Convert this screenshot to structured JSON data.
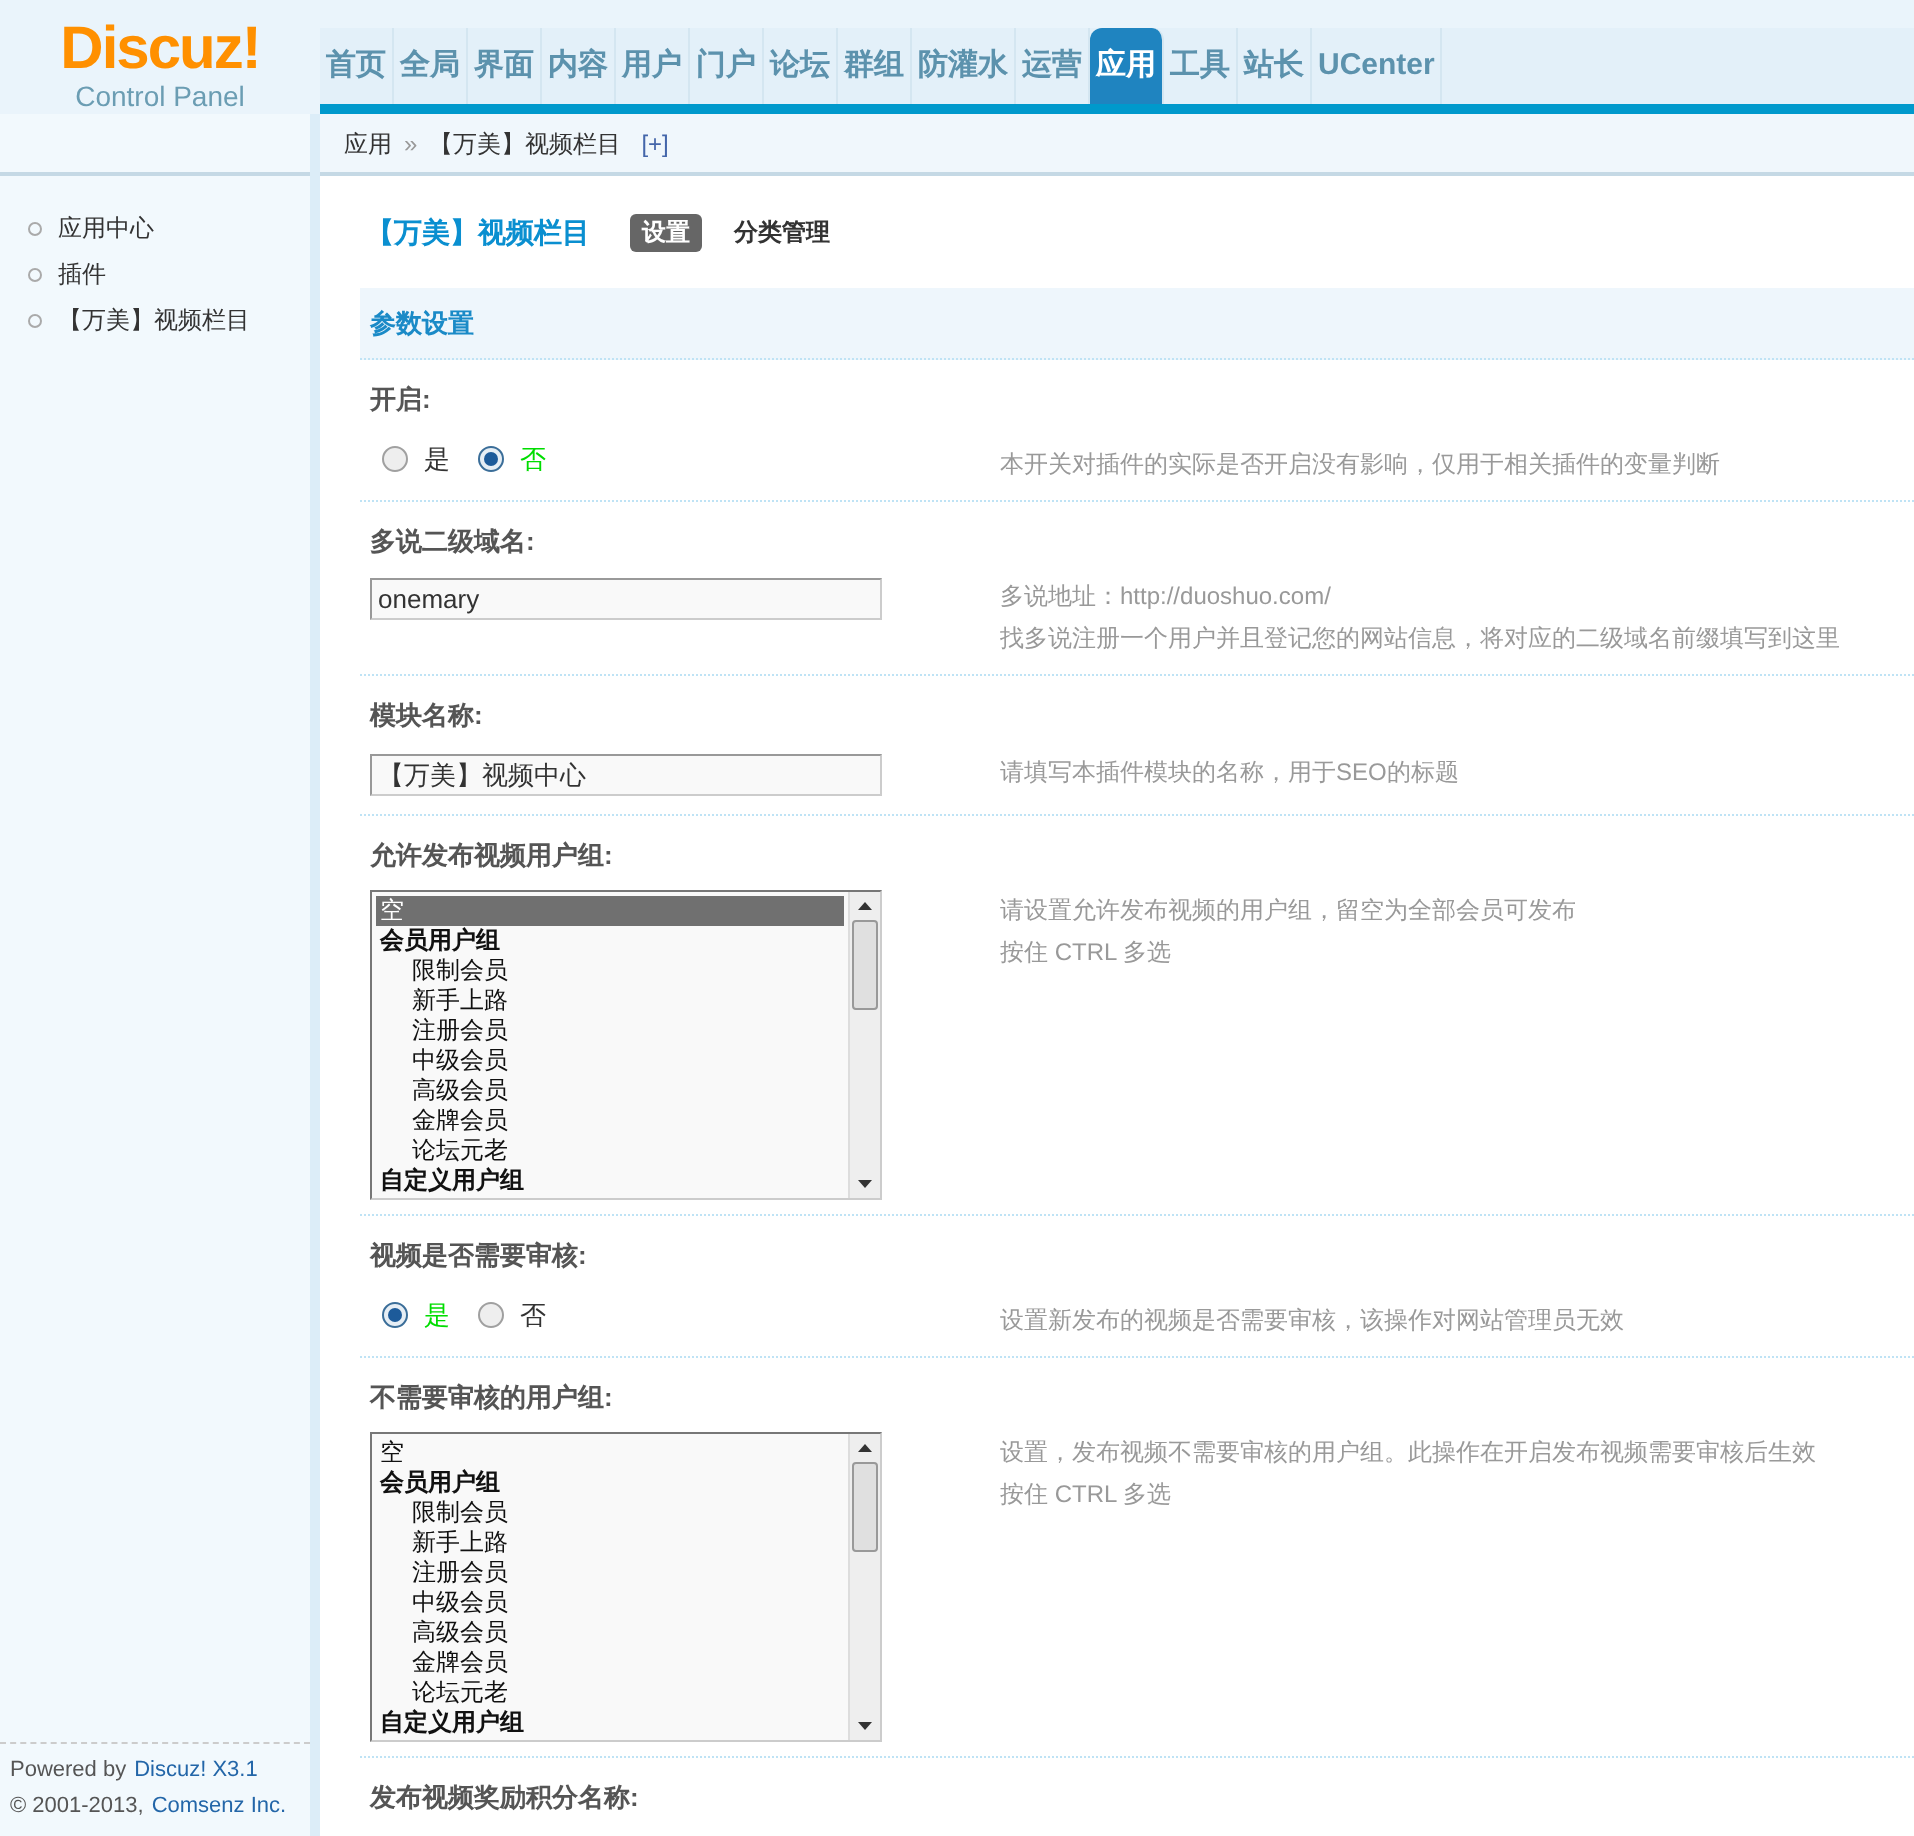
{
  "logo": {
    "brand": "Discuz!",
    "subtitle": "Control Panel"
  },
  "nav": [
    {
      "label": "首页",
      "selected": false
    },
    {
      "label": "全局",
      "selected": false
    },
    {
      "label": "界面",
      "selected": false
    },
    {
      "label": "内容",
      "selected": false
    },
    {
      "label": "用户",
      "selected": false
    },
    {
      "label": "门户",
      "selected": false
    },
    {
      "label": "论坛",
      "selected": false
    },
    {
      "label": "群组",
      "selected": false
    },
    {
      "label": "防灌水",
      "selected": false
    },
    {
      "label": "运营",
      "selected": false
    },
    {
      "label": "应用",
      "selected": true
    },
    {
      "label": "工具",
      "selected": false
    },
    {
      "label": "站长",
      "selected": false
    },
    {
      "label": "UCenter",
      "selected": false
    }
  ],
  "breadcrumb": {
    "items": [
      "应用",
      "【万美】视频栏目"
    ],
    "separator": "»",
    "add": "[+]"
  },
  "sidebar": {
    "items": [
      {
        "label": "应用中心"
      },
      {
        "label": "插件"
      },
      {
        "label": "【万美】视频栏目"
      }
    ]
  },
  "footer": {
    "powered": "Powered by",
    "product": "Discuz! X3.1",
    "copyright": "© 2001-2013,",
    "company": "Comsenz Inc."
  },
  "page": {
    "title": "【万美】视频栏目",
    "tabs": [
      {
        "label": "设置",
        "selected": true
      },
      {
        "label": "分类管理",
        "selected": false
      }
    ],
    "section": "参数设置"
  },
  "fields": [
    {
      "kind": "radio",
      "label": "开启:",
      "options": [
        {
          "label": "是",
          "selected": false
        },
        {
          "label": "否",
          "selected": true
        }
      ],
      "description": [
        "本开关对插件的实际是否开启没有影响，仅用于相关插件的变量判断"
      ]
    },
    {
      "kind": "text",
      "label": "多说二级域名:",
      "value": "onemary",
      "description": [
        "多说地址：http://duoshuo.com/",
        "找多说注册一个用户并且登记您的网站信息，将对应的二级域名前缀填写到这里"
      ]
    },
    {
      "kind": "text",
      "label": "模块名称:",
      "value": "【万美】视频中心",
      "description": [
        "请填写本插件模块的名称，用于SEO的标题"
      ]
    },
    {
      "kind": "multiselect",
      "label": "允许发布视频用户组:",
      "options": [
        {
          "label": "空",
          "kind": "empty",
          "selected": true
        },
        {
          "label": "会员用户组",
          "kind": "group",
          "selected": false
        },
        {
          "label": "限制会员",
          "kind": "item",
          "selected": false
        },
        {
          "label": "新手上路",
          "kind": "item",
          "selected": false
        },
        {
          "label": "注册会员",
          "kind": "item",
          "selected": false
        },
        {
          "label": "中级会员",
          "kind": "item",
          "selected": false
        },
        {
          "label": "高级会员",
          "kind": "item",
          "selected": false
        },
        {
          "label": "金牌会员",
          "kind": "item",
          "selected": false
        },
        {
          "label": "论坛元老",
          "kind": "item",
          "selected": false
        },
        {
          "label": "自定义用户组",
          "kind": "group",
          "selected": false
        }
      ],
      "description": [
        "请设置允许发布视频的用户组，留空为全部会员可发布",
        "按住 CTRL 多选"
      ]
    },
    {
      "kind": "radio",
      "label": "视频是否需要审核:",
      "options": [
        {
          "label": "是",
          "selected": true
        },
        {
          "label": "否",
          "selected": false
        }
      ],
      "description": [
        "设置新发布的视频是否需要审核，该操作对网站管理员无效"
      ]
    },
    {
      "kind": "multiselect",
      "label": "不需要审核的用户组:",
      "options": [
        {
          "label": "空",
          "kind": "empty",
          "selected": false
        },
        {
          "label": "会员用户组",
          "kind": "group",
          "selected": false
        },
        {
          "label": "限制会员",
          "kind": "item",
          "selected": false
        },
        {
          "label": "新手上路",
          "kind": "item",
          "selected": false
        },
        {
          "label": "注册会员",
          "kind": "item",
          "selected": false
        },
        {
          "label": "中级会员",
          "kind": "item",
          "selected": false
        },
        {
          "label": "高级会员",
          "kind": "item",
          "selected": false
        },
        {
          "label": "金牌会员",
          "kind": "item",
          "selected": false
        },
        {
          "label": "论坛元老",
          "kind": "item",
          "selected": false
        },
        {
          "label": "自定义用户组",
          "kind": "group",
          "selected": false
        }
      ],
      "description": [
        "设置，发布视频不需要审核的用户组。此操作在开启发布视频需要审核后生效",
        "按住 CTRL 多选"
      ]
    },
    {
      "kind": "heading",
      "label": "发布视频奖励积分名称:"
    }
  ]
}
